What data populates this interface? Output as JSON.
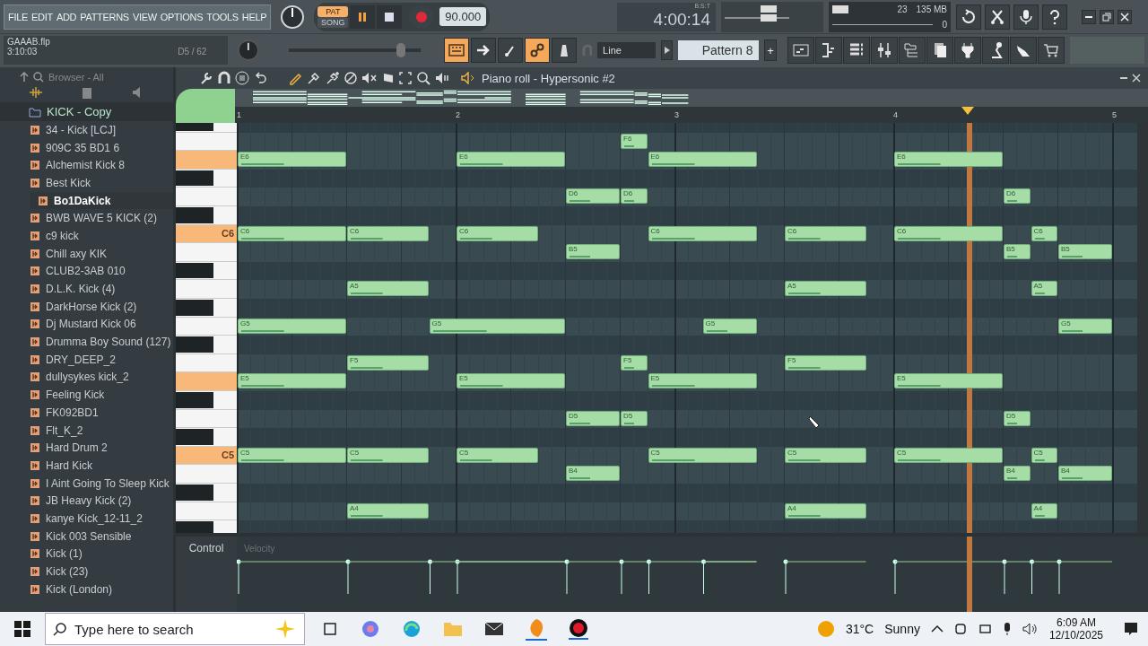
{
  "menu": [
    "FILE",
    "EDIT",
    "ADD",
    "PATTERNS",
    "VIEW",
    "OPTIONS",
    "TOOLS",
    "HELP"
  ],
  "transport": {
    "modes": [
      {
        "label": "PAT",
        "selected": true
      },
      {
        "label": "SONG",
        "selected": false
      }
    ],
    "playing": true,
    "tempo": "90.000",
    "time": "4:00:14",
    "time_format": "B:S:T"
  },
  "meter": {
    "cpu": "23",
    "memory": "135 MB",
    "polyphony": "0"
  },
  "project": {
    "file": "GAAAB.flp",
    "duration": "3:10:03",
    "hint": "D5 / 62"
  },
  "master_volume": {
    "level": 0.85
  },
  "snap": "Line",
  "pattern": "Pattern 8",
  "add_pattern": "+",
  "browser": {
    "title": "Browser - All",
    "folder": "KICK - Copy",
    "items": [
      {
        "label": "34 - Kick [LCJ]",
        "selected": false
      },
      {
        "label": "909C 35 BD1 6",
        "selected": false
      },
      {
        "label": "Alchemist Kick 8",
        "selected": false
      },
      {
        "label": "Best Kick",
        "selected": false
      },
      {
        "label": "Bo1DaKick",
        "selected": true
      },
      {
        "label": "BWB WAVE 5 KICK (2)",
        "selected": false
      },
      {
        "label": "c9 kick",
        "selected": false
      },
      {
        "label": "Chill axy KIK",
        "selected": false
      },
      {
        "label": "CLUB2-3AB 010",
        "selected": false
      },
      {
        "label": "D.L.K. Kick (4)",
        "selected": false
      },
      {
        "label": "DarkHorse Kick (2)",
        "selected": false
      },
      {
        "label": "Dj Mustard Kick 06",
        "selected": false
      },
      {
        "label": "Drumma Boy Sound (127)",
        "selected": false
      },
      {
        "label": "DRY_DEEP_2",
        "selected": false
      },
      {
        "label": "dullysykes kick_2",
        "selected": false
      },
      {
        "label": "Feeling Kick",
        "selected": false
      },
      {
        "label": "FK092BD1",
        "selected": false
      },
      {
        "label": "Flt_K_2",
        "selected": false
      },
      {
        "label": "Hard Drum 2",
        "selected": false
      },
      {
        "label": "Hard Kick",
        "selected": false
      },
      {
        "label": "I Aint Going To Sleep Kick",
        "selected": false
      },
      {
        "label": "JB Heavy Kick (2)",
        "selected": false
      },
      {
        "label": "kanye Kick_12-11_2",
        "selected": false
      },
      {
        "label": "Kick 003 Sensible",
        "selected": false
      },
      {
        "label": "Kick (1)",
        "selected": false
      },
      {
        "label": "Kick (23)",
        "selected": false
      },
      {
        "label": "Kick (London)",
        "selected": false
      }
    ]
  },
  "piano_roll": {
    "title": "Piano roll - Hypersonic #2",
    "bars": [
      "1",
      "2",
      "3",
      "4",
      "5"
    ],
    "rows": [
      {
        "black": true,
        "highlighted": false,
        "notes": []
      },
      {
        "black": false,
        "highlighted": false,
        "notes": [
          "F6"
        ]
      },
      {
        "black": false,
        "highlighted": true,
        "notes": [
          "E6",
          "E6",
          "E6",
          "E6"
        ]
      },
      {
        "black": true,
        "highlighted": false,
        "notes": []
      },
      {
        "black": false,
        "highlighted": false,
        "notes": [
          "D6",
          "D6",
          "D6"
        ]
      },
      {
        "black": true,
        "highlighted": false,
        "notes": []
      },
      {
        "black": false,
        "highlighted": true,
        "key_label": "C6",
        "notes": [
          "C6",
          "C6",
          "C6",
          "C6",
          "C6",
          "C6",
          "C6"
        ]
      },
      {
        "black": false,
        "highlighted": false,
        "notes": [
          "B5",
          "B5",
          "B5"
        ]
      },
      {
        "black": true,
        "highlighted": false,
        "notes": []
      },
      {
        "black": false,
        "highlighted": false,
        "notes": [
          "A5",
          "A5",
          "A5"
        ]
      },
      {
        "black": true,
        "highlighted": false,
        "notes": []
      },
      {
        "black": false,
        "highlighted": false,
        "notes": [
          "G5",
          "G5",
          "G5",
          "G5"
        ]
      },
      {
        "black": true,
        "highlighted": false,
        "notes": []
      },
      {
        "black": false,
        "highlighted": false,
        "notes": [
          "F5",
          "F5",
          "F5"
        ]
      },
      {
        "black": false,
        "highlighted": true,
        "notes": [
          "E5",
          "E5",
          "E5",
          "E5"
        ]
      },
      {
        "black": true,
        "highlighted": false,
        "notes": []
      },
      {
        "black": false,
        "highlighted": false,
        "notes": [
          "D5",
          "D5",
          "D5"
        ]
      },
      {
        "black": true,
        "highlighted": false,
        "notes": []
      },
      {
        "black": false,
        "highlighted": true,
        "key_label": "C5",
        "notes": [
          "C5",
          "C5",
          "C5",
          "C5",
          "C5",
          "C5",
          "C5"
        ]
      },
      {
        "black": false,
        "highlighted": false,
        "notes": [
          "B4",
          "B4",
          "B4"
        ]
      },
      {
        "black": true,
        "highlighted": false,
        "notes": []
      },
      {
        "black": false,
        "highlighted": false,
        "notes": [
          "A4",
          "A4",
          "A4"
        ]
      },
      {
        "black": true,
        "highlighted": false,
        "notes": []
      }
    ],
    "control": {
      "label": "Control",
      "parameter": "Velocity"
    }
  },
  "taskbar": {
    "search_placeholder": "Type here to search",
    "temperature": "31°C",
    "weather": "Sunny",
    "time": "6:09 AM",
    "date": "12/10/2025"
  }
}
